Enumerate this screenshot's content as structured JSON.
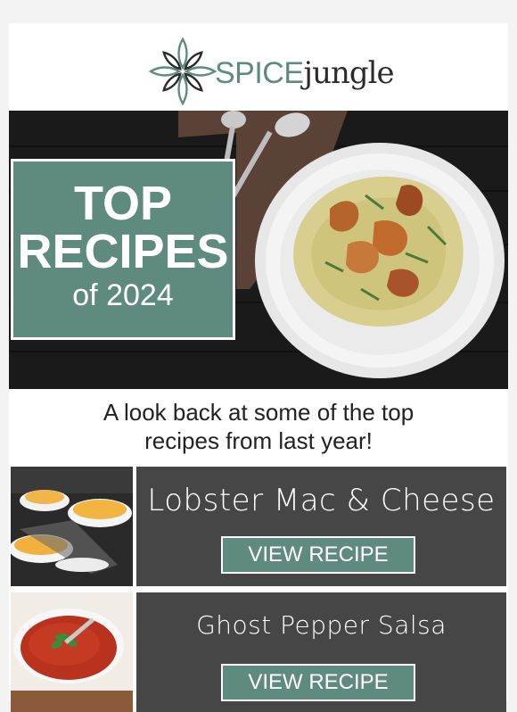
{
  "brand": {
    "logo_icon": "leaf-burst-icon",
    "name_part1": "SPICE",
    "name_part2": "jungle",
    "accent_color": "#5f8a7f",
    "dark_color": "#464646"
  },
  "hero": {
    "line1": "TOP",
    "line2": "RECIPES",
    "line3": "of 2024",
    "image": "risotto-with-mushrooms-photo"
  },
  "intro": {
    "line1": "A look back at some of the top",
    "line2": "recipes from last year!"
  },
  "recipes": [
    {
      "title": "Lobster Mac & Cheese",
      "button": "VIEW RECIPE",
      "image": "mac-and-cheese-bowls-photo"
    },
    {
      "title": "Ghost Pepper Salsa",
      "button": "VIEW RECIPE",
      "image": "red-salsa-bowl-photo"
    }
  ]
}
